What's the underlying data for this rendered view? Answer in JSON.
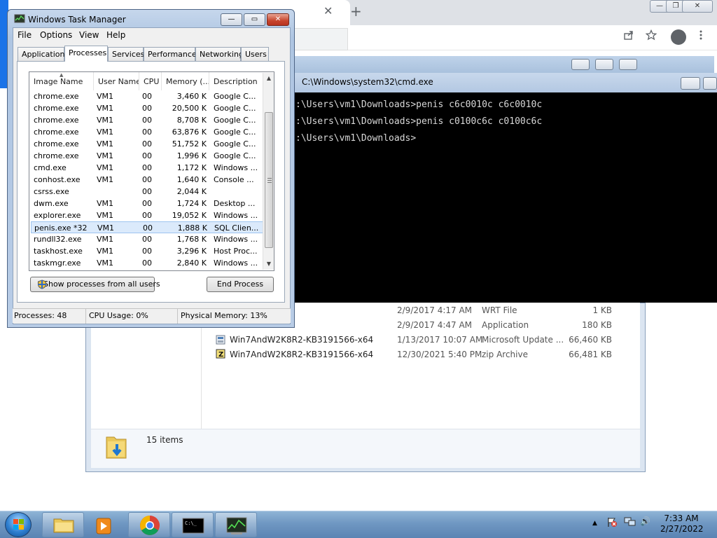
{
  "chrome": {
    "tab_close": "✕",
    "new_tab": "+",
    "minimize": "—",
    "maximize": "❐",
    "close": "✕"
  },
  "cmd": {
    "title": "C:\\Windows\\system32\\cmd.exe",
    "lines": [
      ":\\Users\\vm1\\Downloads>penis c6c0010c c6c0010c",
      ":\\Users\\vm1\\Downloads>penis c0100c6c c0100c6c",
      ":\\Users\\vm1\\Downloads>"
    ]
  },
  "explorer": {
    "rows": [
      {
        "name": "",
        "date": "2/9/2017 4:17 AM",
        "type": "WRT File",
        "size": "1 KB"
      },
      {
        "name": "",
        "date": "2/9/2017 4:47 AM",
        "type": "Application",
        "size": "180 KB"
      },
      {
        "name": "Win7AndW2K8R2-KB3191566-x64",
        "date": "1/13/2017 10:07 AM",
        "type": "Microsoft Update ...",
        "size": "66,460 KB"
      },
      {
        "name": "Win7AndW2K8R2-KB3191566-x64",
        "date": "12/30/2021 5:40 PM",
        "type": "zip Archive",
        "size": "66,481 KB"
      }
    ],
    "item_count": "15 items"
  },
  "taskmgr": {
    "title": "Windows Task Manager",
    "menu": [
      "File",
      "Options",
      "View",
      "Help"
    ],
    "tabs": [
      "Applications",
      "Processes",
      "Services",
      "Performance",
      "Networking",
      "Users"
    ],
    "active_tab": "Processes",
    "columns": [
      "Image Name",
      "User Name",
      "CPU",
      "Memory (...",
      "Description"
    ],
    "processes": [
      {
        "image": "chrome.exe",
        "user": "VM1",
        "cpu": "00",
        "mem": "3,460 K",
        "desc": "Google C..."
      },
      {
        "image": "chrome.exe",
        "user": "VM1",
        "cpu": "00",
        "mem": "20,500 K",
        "desc": "Google C..."
      },
      {
        "image": "chrome.exe",
        "user": "VM1",
        "cpu": "00",
        "mem": "8,708 K",
        "desc": "Google C..."
      },
      {
        "image": "chrome.exe",
        "user": "VM1",
        "cpu": "00",
        "mem": "63,876 K",
        "desc": "Google C..."
      },
      {
        "image": "chrome.exe",
        "user": "VM1",
        "cpu": "00",
        "mem": "51,752 K",
        "desc": "Google C..."
      },
      {
        "image": "chrome.exe",
        "user": "VM1",
        "cpu": "00",
        "mem": "1,996 K",
        "desc": "Google C..."
      },
      {
        "image": "cmd.exe",
        "user": "VM1",
        "cpu": "00",
        "mem": "1,172 K",
        "desc": "Windows ..."
      },
      {
        "image": "conhost.exe",
        "user": "VM1",
        "cpu": "00",
        "mem": "1,640 K",
        "desc": "Console ..."
      },
      {
        "image": "csrss.exe",
        "user": "",
        "cpu": "00",
        "mem": "2,044 K",
        "desc": ""
      },
      {
        "image": "dwm.exe",
        "user": "VM1",
        "cpu": "00",
        "mem": "1,724 K",
        "desc": "Desktop ..."
      },
      {
        "image": "explorer.exe",
        "user": "VM1",
        "cpu": "00",
        "mem": "19,052 K",
        "desc": "Windows ..."
      },
      {
        "image": "penis.exe *32",
        "user": "VM1",
        "cpu": "00",
        "mem": "1,888 K",
        "desc": "SQL Clien..."
      },
      {
        "image": "rundll32.exe",
        "user": "VM1",
        "cpu": "00",
        "mem": "1,768 K",
        "desc": "Windows ..."
      },
      {
        "image": "taskhost.exe",
        "user": "VM1",
        "cpu": "00",
        "mem": "3,296 K",
        "desc": "Host Proc..."
      },
      {
        "image": "taskmgr.exe",
        "user": "VM1",
        "cpu": "00",
        "mem": "2,840 K",
        "desc": "Windows ..."
      }
    ],
    "selected_index": 11,
    "show_all_label": "Show processes from all users",
    "end_process_label": "End Process",
    "status": {
      "processes": "Processes: 48",
      "cpu": "CPU Usage: 0%",
      "memory": "Physical Memory: 13%"
    },
    "title_buttons": {
      "minimize": "—",
      "maximize": "▭",
      "close": "✕"
    }
  },
  "taskbar": {
    "time": "7:33 AM",
    "date": "2/27/2022",
    "tray_arrow": "▲",
    "volume": "🔊"
  },
  "colors": {
    "taskbar": "#6f97c2",
    "selection": "#dbeafb",
    "cmd_bg": "#000000"
  }
}
